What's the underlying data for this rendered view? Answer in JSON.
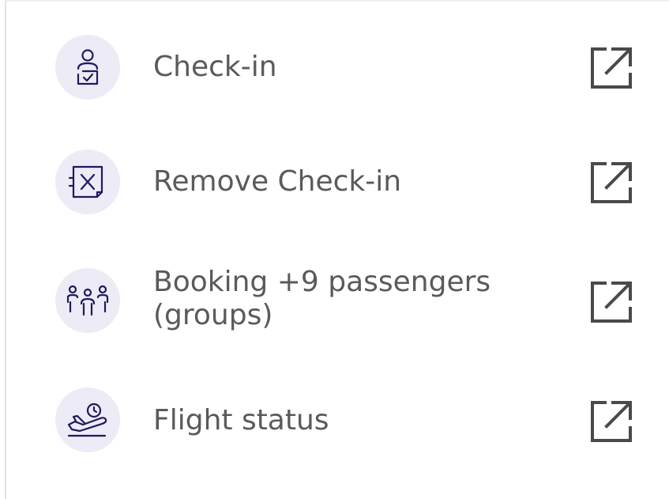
{
  "menu": {
    "items": [
      {
        "id": "check-in",
        "label": "Check-in",
        "icon": "person-check-icon",
        "action_icon": "external-link-icon"
      },
      {
        "id": "remove-check-in",
        "label": "Remove Check-in",
        "icon": "boarding-pass-x-icon",
        "action_icon": "external-link-icon"
      },
      {
        "id": "group-booking",
        "label": "Booking +9 passengers (groups)",
        "icon": "group-people-icon",
        "action_icon": "external-link-icon"
      },
      {
        "id": "flight-status",
        "label": "Flight status",
        "icon": "plane-clock-icon",
        "action_icon": "external-link-icon"
      }
    ]
  },
  "colors": {
    "icon_badge_bg": "#ecebf6",
    "icon_stroke": "#1f1a5c",
    "text": "#5a5a5a",
    "external_icon": "#4a4a4a"
  }
}
